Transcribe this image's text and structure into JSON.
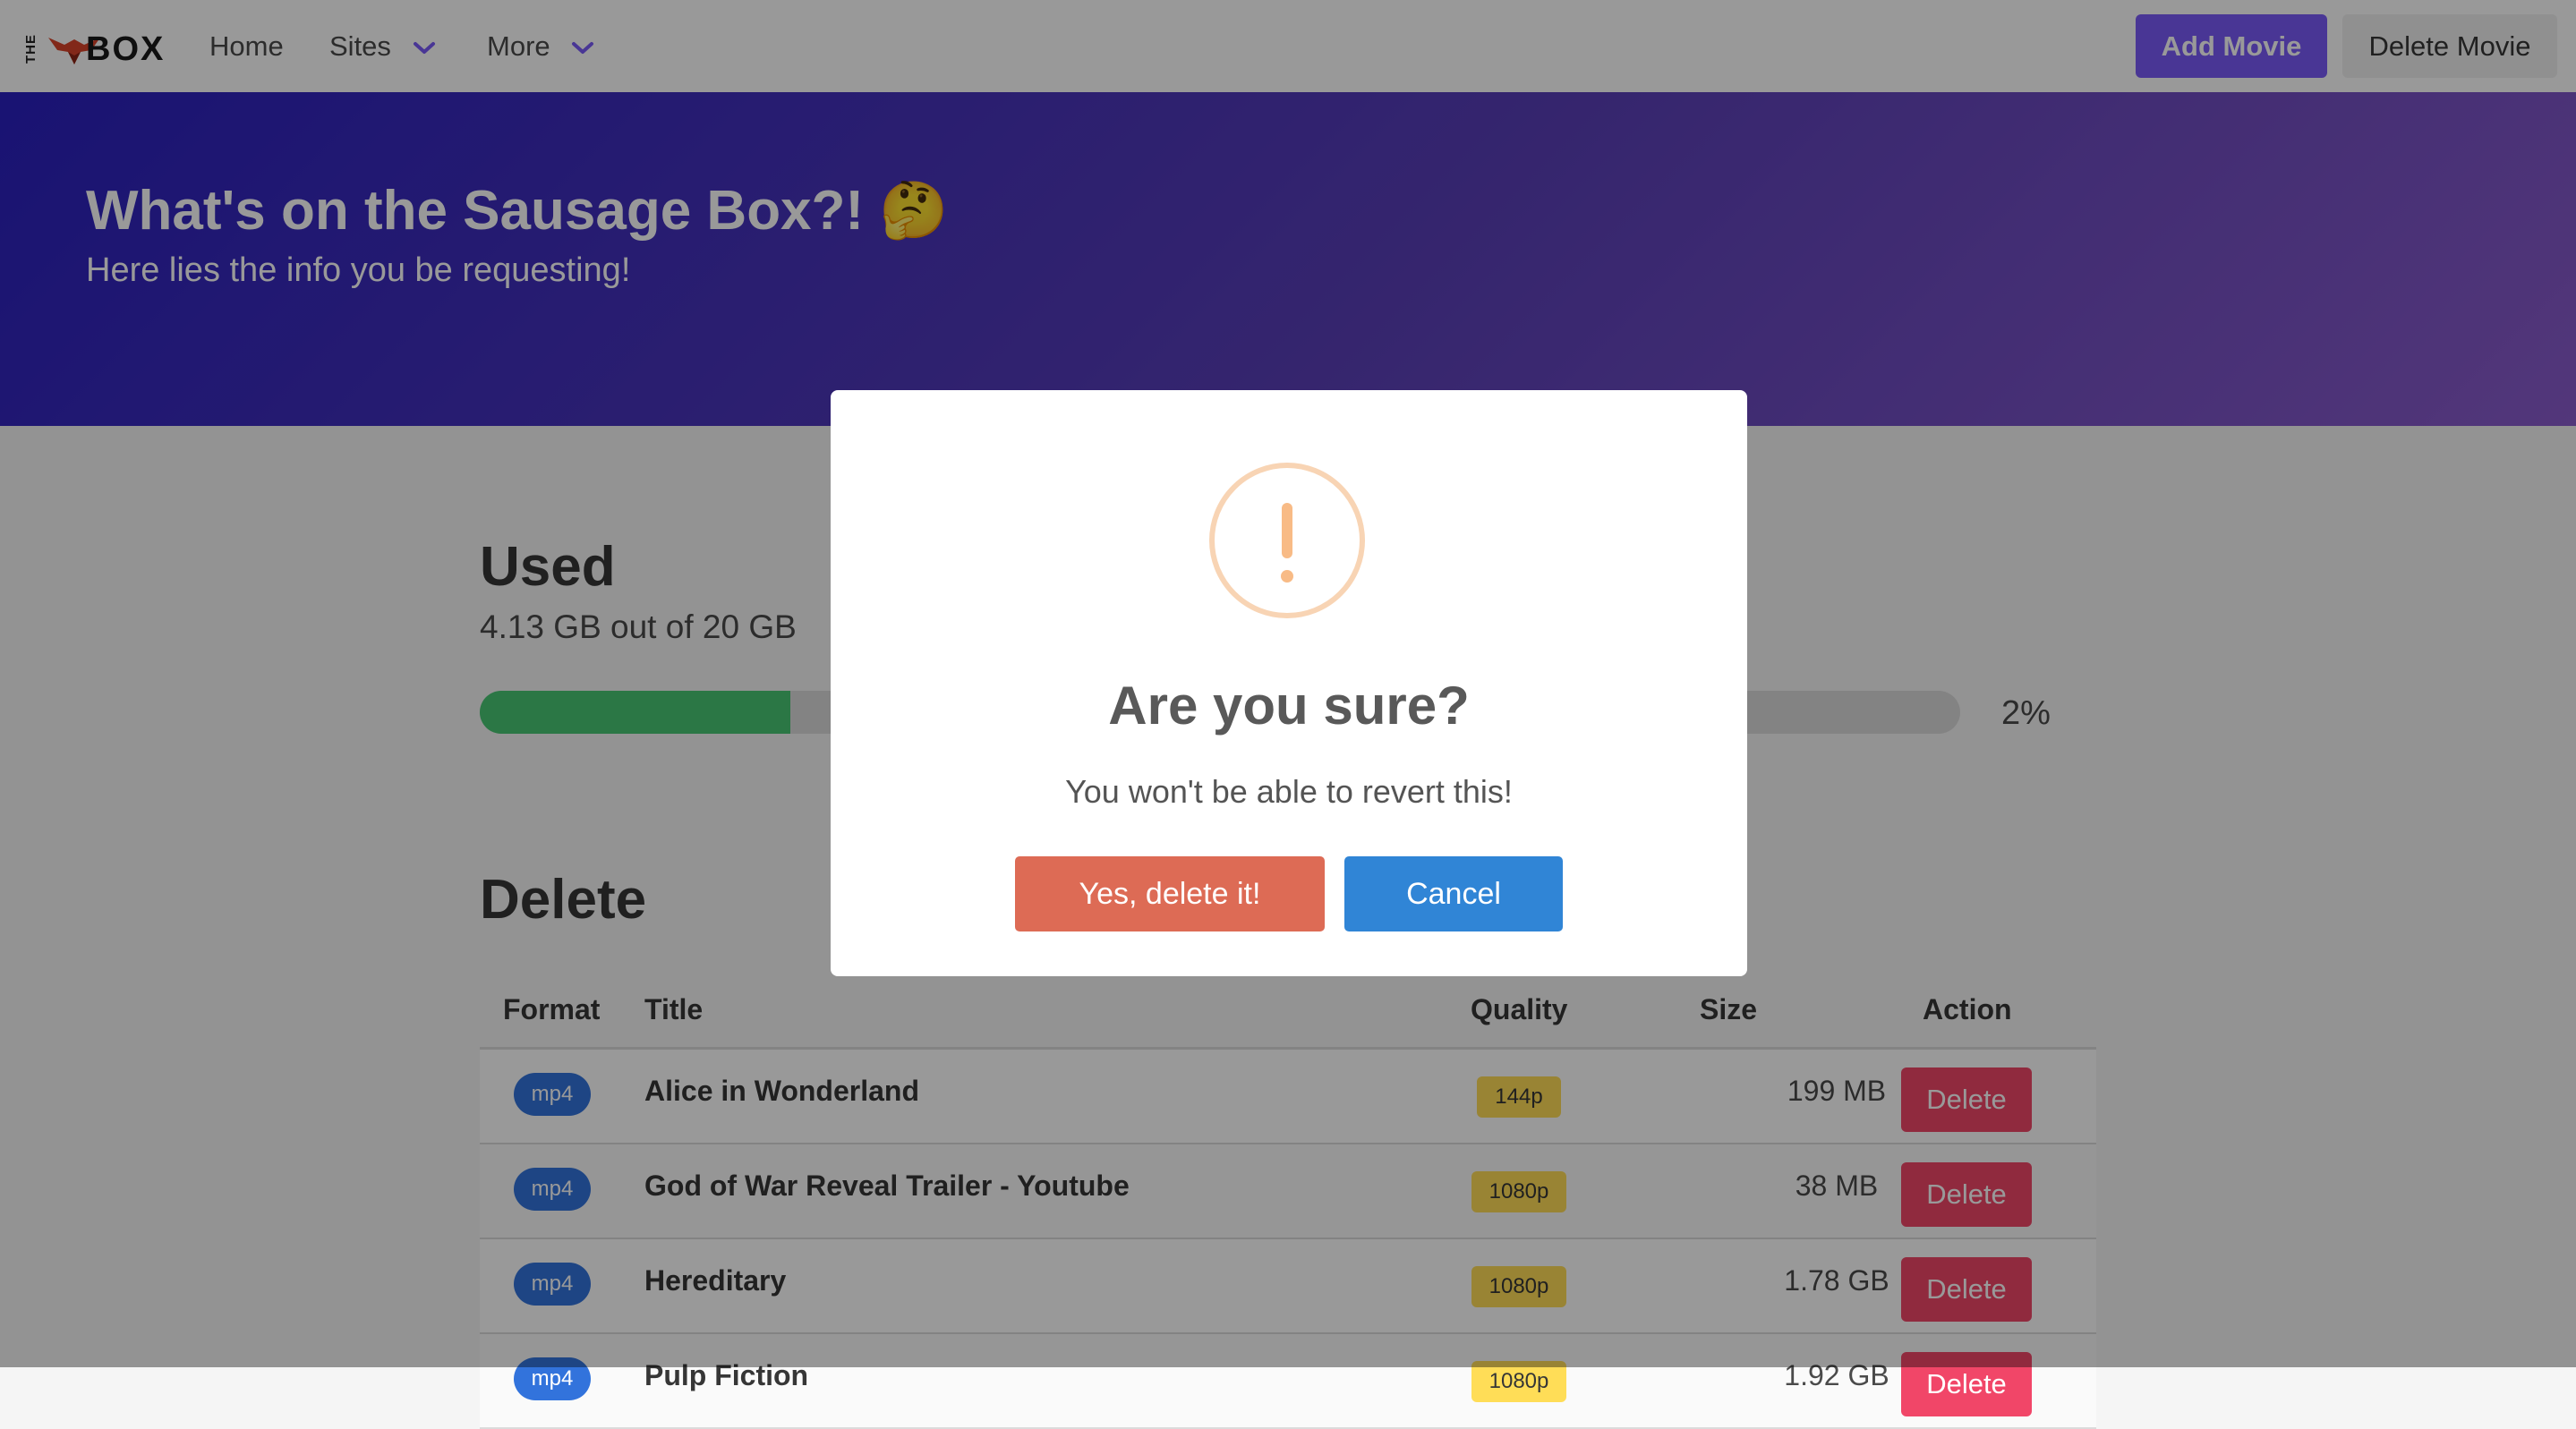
{
  "navbar": {
    "logo_the": "THE",
    "logo_box": "BOX",
    "items": [
      {
        "label": "Home"
      },
      {
        "label": "Sites"
      },
      {
        "label": "More"
      }
    ],
    "add_movie_label": "Add Movie",
    "delete_movie_label": "Delete Movie",
    "accent_color": "#7a5af8"
  },
  "hero": {
    "title": "What's on the Sausage Box?! 🤔",
    "subtitle": "Here lies the info you be requesting!"
  },
  "usage": {
    "title": "Used",
    "summary": "4.13 GB out of 20 GB",
    "progress_fraction": 0.21,
    "percent_label": "2%"
  },
  "delete_section": {
    "title": "Delete",
    "columns": [
      "Format",
      "Title",
      "Quality",
      "Size",
      "Action"
    ],
    "rows": [
      {
        "format": "mp4",
        "title": "Alice in Wonderland",
        "quality": "144p",
        "size": "199 MB",
        "action": "Delete"
      },
      {
        "format": "mp4",
        "title": "God of War Reveal Trailer - Youtube",
        "quality": "1080p",
        "size": "38 MB",
        "action": "Delete"
      },
      {
        "format": "mp4",
        "title": "Hereditary",
        "quality": "1080p",
        "size": "1.78 GB",
        "action": "Delete"
      },
      {
        "format": "mp4",
        "title": "Pulp Fiction",
        "quality": "1080p",
        "size": "1.92 GB",
        "action": "Delete"
      }
    ]
  },
  "modal": {
    "icon": "exclamation-icon",
    "icon_color": "#f8bb86",
    "title": "Are you sure?",
    "text": "You won't be able to revert this!",
    "confirm_label": "Yes, delete it!",
    "cancel_label": "Cancel"
  }
}
